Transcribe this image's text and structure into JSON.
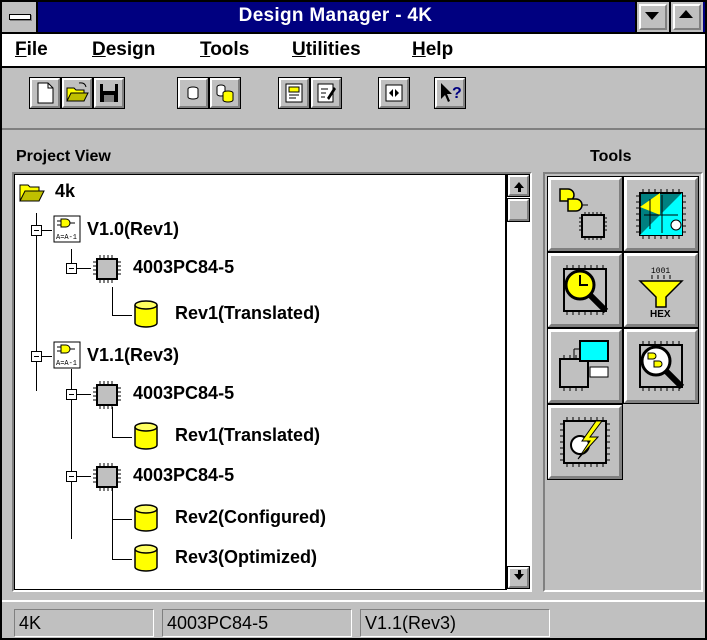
{
  "window": {
    "title": "Design Manager - 4K"
  },
  "menu": {
    "items": [
      {
        "label": "File",
        "key": "F",
        "rest": "ile"
      },
      {
        "label": "Design",
        "key": "D",
        "rest": "esign"
      },
      {
        "label": "Tools",
        "key": "T",
        "rest": "ools"
      },
      {
        "label": "Utilities",
        "key": "U",
        "rest": "tilities"
      },
      {
        "label": "Help",
        "key": "H",
        "rest": "elp"
      }
    ]
  },
  "toolbar": {
    "buttons": [
      "new-project",
      "open-project",
      "save-project",
      "new-version",
      "new-revision",
      "edit-properties",
      "edit-notes",
      "navigate",
      "context-help"
    ]
  },
  "project_view": {
    "label": "Project View",
    "root": "4k",
    "nodes": {
      "v10": "V1.0(Rev1)",
      "v10_dev": "4003PC84-5",
      "v10_rev1": "Rev1(Translated)",
      "v11": "V1.1(Rev3)",
      "v11_dev1": "4003PC84-5",
      "v11_rev1": "Rev1(Translated)",
      "v11_dev2": "4003PC84-5",
      "v11_rev2": "Rev2(Configured)",
      "v11_rev3": "Rev3(Optimized)"
    },
    "version_icon_text": "A=A-1"
  },
  "tools": {
    "label": "Tools",
    "hex_label": "HEX",
    "hex_bits": "1001"
  },
  "status": {
    "project": "4K",
    "device": "4003PC84-5",
    "version": "V1.1(Rev3)"
  },
  "colors": {
    "titlebar": "#000080",
    "face": "#c0c0c0",
    "folder_yellow": "#ffff00",
    "teal": "#008080",
    "cyan": "#00ffff"
  }
}
